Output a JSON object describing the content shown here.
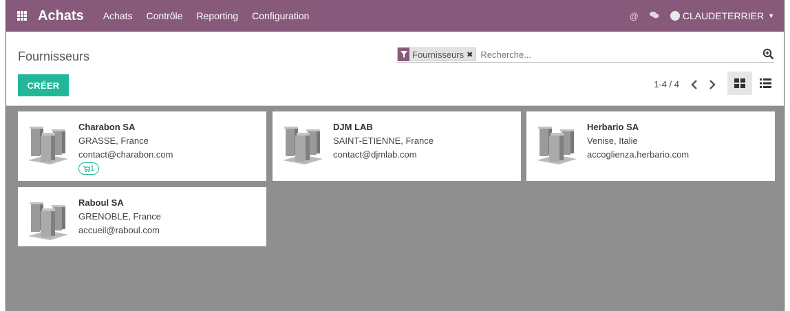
{
  "navbar": {
    "app_title": "Achats",
    "menus": [
      "Achats",
      "Contrôle",
      "Reporting",
      "Configuration"
    ],
    "user_name": "CLAUDETERRIER",
    "icons": [
      "apps-icon",
      "at-icon",
      "chat-icon",
      "avatar",
      "caret-down-icon"
    ],
    "color": "#875a7b"
  },
  "control_panel": {
    "title": "Fournisseurs",
    "create_label": "CRÉER",
    "search": {
      "facet_label": "Fournisseurs",
      "facet_remove": "✖",
      "placeholder": "Recherche..."
    },
    "pager": "1-4 / 4",
    "accent_color": "#21b799"
  },
  "cards": [
    {
      "name": "Charabon SA",
      "location": "GRASSE, France",
      "email": "contact@charabon.com",
      "badge": "1"
    },
    {
      "name": "DJM LAB",
      "location": "SAINT-ETIENNE, France",
      "email": "contact@djmlab.com",
      "badge": ""
    },
    {
      "name": "Herbario SA",
      "location": "Venise, Italie",
      "email": "accoglienza.herbario.com",
      "badge": ""
    },
    {
      "name": "Raboul SA",
      "location": "GRENOBLE, France",
      "email": "accueil@raboul.com",
      "badge": ""
    }
  ]
}
